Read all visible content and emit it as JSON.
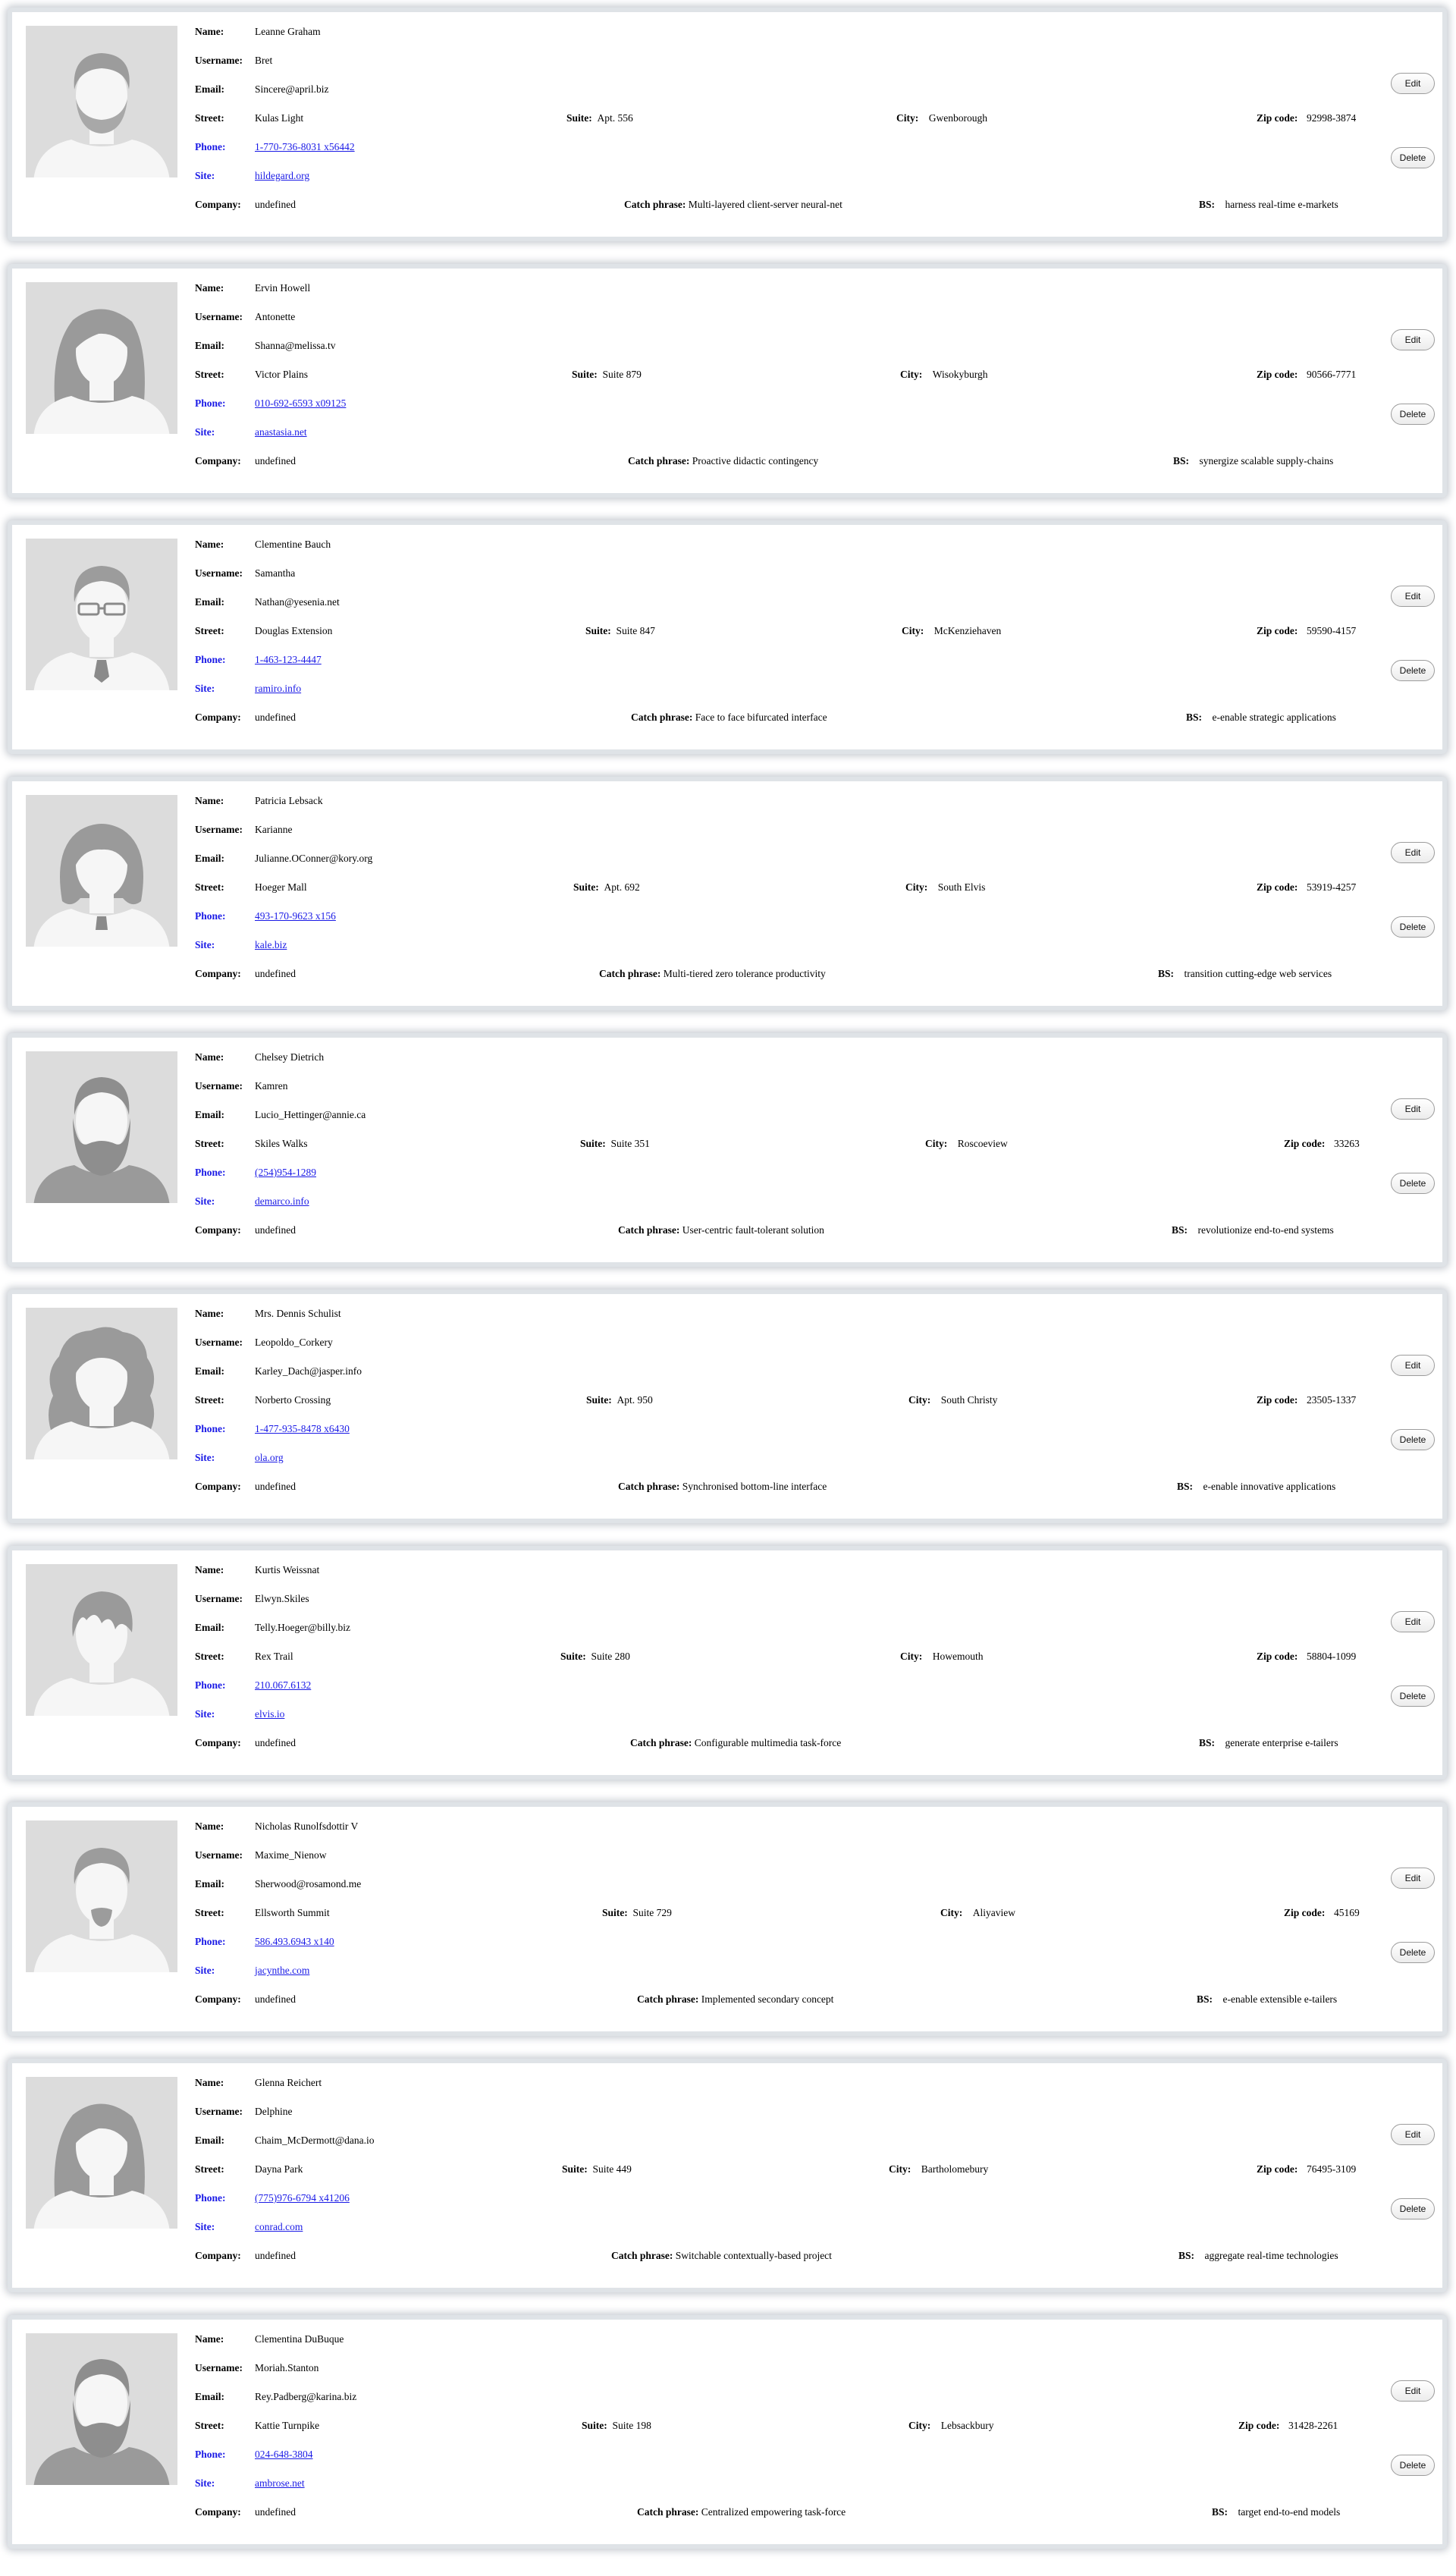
{
  "labels": {
    "name": "Name:",
    "username": "Username:",
    "email": "Email:",
    "street": "Street:",
    "suite": "Suite:",
    "city": "City:",
    "zipcode": "Zip code:",
    "phone": "Phone:",
    "site": "Site:",
    "company": "Company:",
    "catch_phrase": "Catch phrase:",
    "bs": "BS:",
    "edit": "Edit",
    "delete": "Delete"
  },
  "users": [
    {
      "name": "Leanne Graham",
      "username": "Bret",
      "email": "Sincere@april.biz",
      "street": "Kulas Light",
      "suite": "Apt. 556",
      "city": "Gwenborough",
      "zipcode": "92998-3874",
      "phone": "1-770-736-8031 x56442",
      "site": "hildegard.org",
      "company": "undefined",
      "catch_phrase": "Multi-layered client-server neural-net",
      "bs": "harness real-time e-markets",
      "avatar": "man-beard-icon"
    },
    {
      "name": "Ervin Howell",
      "username": "Antonette",
      "email": "Shanna@melissa.tv",
      "street": "Victor Plains",
      "suite": "Suite 879",
      "city": "Wisokyburgh",
      "zipcode": "90566-7771",
      "phone": "010-692-6593 x09125",
      "site": "anastasia.net",
      "company": "undefined",
      "catch_phrase": "Proactive didactic contingency",
      "bs": "synergize scalable supply-chains",
      "avatar": "woman-long-hair-icon"
    },
    {
      "name": "Clementine Bauch",
      "username": "Samantha",
      "email": "Nathan@yesenia.net",
      "street": "Douglas Extension",
      "suite": "Suite 847",
      "city": "McKenziehaven",
      "zipcode": "59590-4157",
      "phone": "1-463-123-4447",
      "site": "ramiro.info",
      "company": "undefined",
      "catch_phrase": "Face to face bifurcated interface",
      "bs": "e-enable strategic applications",
      "avatar": "man-glasses-icon"
    },
    {
      "name": "Patricia Lebsack",
      "username": "Karianne",
      "email": "Julianne.OConner@kory.org",
      "street": "Hoeger Mall",
      "suite": "Apt. 692",
      "city": "South Elvis",
      "zipcode": "53919-4257",
      "phone": "493-170-9623 x156",
      "site": "kale.biz",
      "company": "undefined",
      "catch_phrase": "Multi-tiered zero tolerance productivity",
      "bs": "transition cutting-edge web services",
      "avatar": "woman-bob-icon"
    },
    {
      "name": "Chelsey Dietrich",
      "username": "Kamren",
      "email": "Lucio_Hettinger@annie.ca",
      "street": "Skiles Walks",
      "suite": "Suite 351",
      "city": "Roscoeview",
      "zipcode": "33263",
      "phone": "(254)954-1289",
      "site": "demarco.info",
      "company": "undefined",
      "catch_phrase": "User-centric fault-tolerant solution",
      "bs": "revolutionize end-to-end systems",
      "avatar": "man-full-beard-icon"
    },
    {
      "name": "Mrs. Dennis Schulist",
      "username": "Leopoldo_Corkery",
      "email": "Karley_Dach@jasper.info",
      "street": "Norberto Crossing",
      "suite": "Apt. 950",
      "city": "South Christy",
      "zipcode": "23505-1337",
      "phone": "1-477-935-8478 x6430",
      "site": "ola.org",
      "company": "undefined",
      "catch_phrase": "Synchronised bottom-line interface",
      "bs": "e-enable innovative applications",
      "avatar": "woman-curly-hair-icon"
    },
    {
      "name": "Kurtis Weissnat",
      "username": "Elwyn.Skiles",
      "email": "Telly.Hoeger@billy.biz",
      "street": "Rex Trail",
      "suite": "Suite 280",
      "city": "Howemouth",
      "zipcode": "58804-1099",
      "phone": "210.067.6132",
      "site": "elvis.io",
      "company": "undefined",
      "catch_phrase": "Configurable multimedia task-force",
      "bs": "generate enterprise e-tailers",
      "avatar": "man-fringe-icon"
    },
    {
      "name": "Nicholas Runolfsdottir V",
      "username": "Maxime_Nienow",
      "email": "Sherwood@rosamond.me",
      "street": "Ellsworth Summit",
      "suite": "Suite 729",
      "city": "Aliyaview",
      "zipcode": "45169",
      "phone": "586.493.6943 x140",
      "site": "jacynthe.com",
      "company": "undefined",
      "catch_phrase": "Implemented secondary concept",
      "bs": "e-enable extensible e-tailers",
      "avatar": "man-goatee-icon"
    },
    {
      "name": "Glenna Reichert",
      "username": "Delphine",
      "email": "Chaim_McDermott@dana.io",
      "street": "Dayna Park",
      "suite": "Suite 449",
      "city": "Bartholomebury",
      "zipcode": "76495-3109",
      "phone": "(775)976-6794 x41206",
      "site": "conrad.com",
      "company": "undefined",
      "catch_phrase": "Switchable contextually-based project",
      "bs": "aggregate real-time technologies",
      "avatar": "woman-long-hair-icon"
    },
    {
      "name": "Clementina DuBuque",
      "username": "Moriah.Stanton",
      "email": "Rey.Padberg@karina.biz",
      "street": "Kattie Turnpike",
      "suite": "Suite 198",
      "city": "Lebsackbury",
      "zipcode": "31428-2261",
      "phone": "024-648-3804",
      "site": "ambrose.net",
      "company": "undefined",
      "catch_phrase": "Centralized empowering task-force",
      "bs": "target end-to-end models",
      "avatar": "man-full-beard-icon"
    }
  ]
}
